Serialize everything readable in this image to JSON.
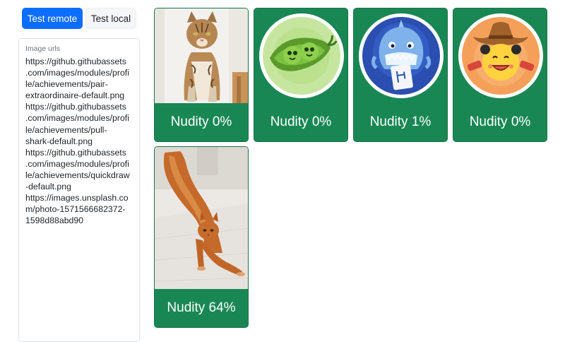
{
  "toolbar": {
    "test_remote_label": "Test remote",
    "test_local_label": "Test local"
  },
  "urls_field": {
    "label": "Image urls",
    "value": "https://github.githubassets\n.com/images/modules/profi\nle/achievements/pair-\nextraordinaire-default.png\nhttps://github.githubassets\n.com/images/modules/profi\nle/achievements/pull-\nshark-default.png\nhttps://github.githubassets\n.com/images/modules/profi\nle/achievements/quickdraw\n-default.png\nhttps://images.unsplash.co\nm/photo-1571566682372-\n1598d88abd90"
  },
  "results": [
    {
      "subject": "sitting tabby cat photo",
      "caption": "Nudity 0%"
    },
    {
      "subject": "pair extraordinaire peas badge",
      "caption": "Nudity 0%"
    },
    {
      "subject": "pull shark badge",
      "caption": "Nudity 1%"
    },
    {
      "subject": "quickdraw cowboy badge",
      "caption": "Nudity 0%"
    },
    {
      "subject": "stretching orange cat photo",
      "caption": "Nudity 64%"
    }
  ],
  "colors": {
    "primary": "#0d6efd",
    "success": "#198754"
  }
}
